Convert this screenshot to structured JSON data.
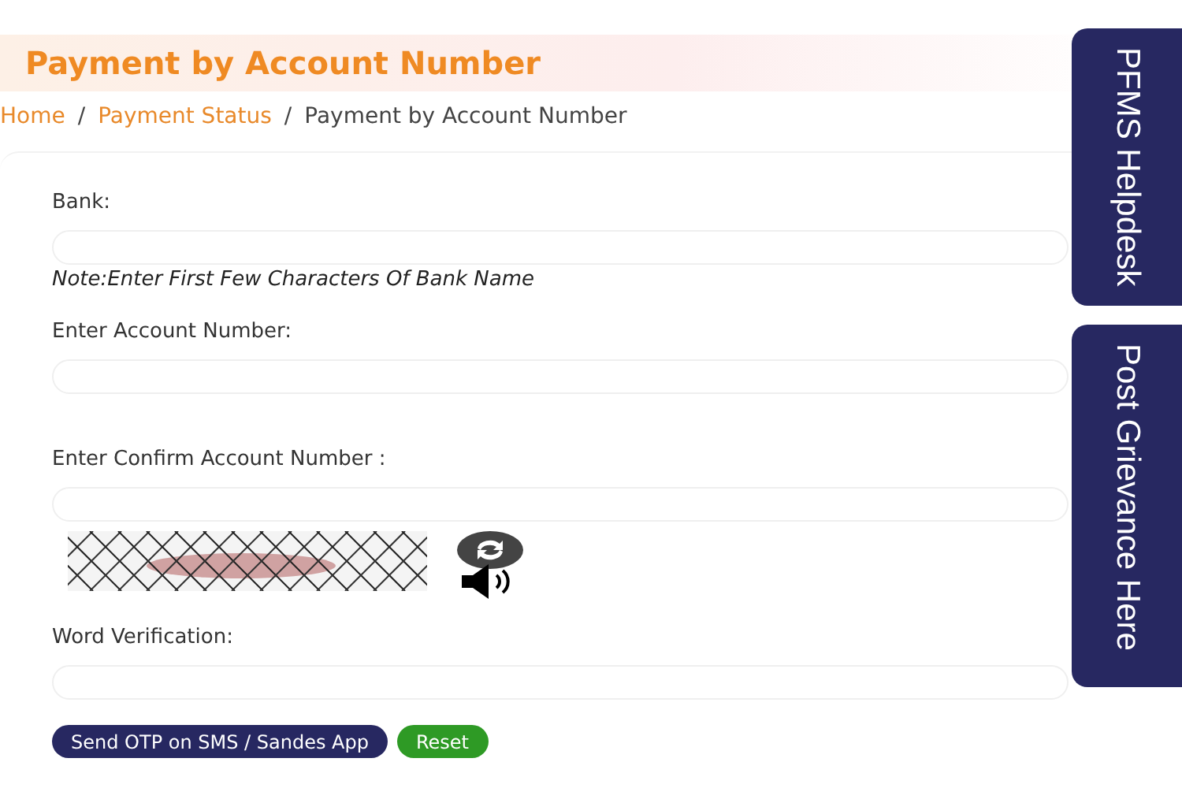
{
  "header": {
    "title": "Payment by Account Number"
  },
  "breadcrumb": [
    {
      "label": "Home",
      "kind": "link"
    },
    {
      "label": "Payment Status",
      "kind": "link"
    },
    {
      "label": "Payment by Account Number",
      "kind": "current"
    }
  ],
  "separator": "/",
  "form": {
    "fields": [
      {
        "label": "Bank:",
        "note": "Note:Enter First Few Characters Of Bank Name"
      },
      {
        "label": "Enter Account Number:"
      },
      {
        "label": "Enter Confirm Account Number :"
      }
    ],
    "verification": {
      "label": "Word Verification:"
    },
    "buttons": [
      {
        "label": "Send OTP on SMS / Sandes App",
        "kind": "primary"
      },
      {
        "label": "Reset",
        "kind": "success"
      }
    ]
  },
  "side_tabs": [
    {
      "label": "PFMS Helpdesk"
    },
    {
      "label": "Post Grievance Here"
    }
  ]
}
